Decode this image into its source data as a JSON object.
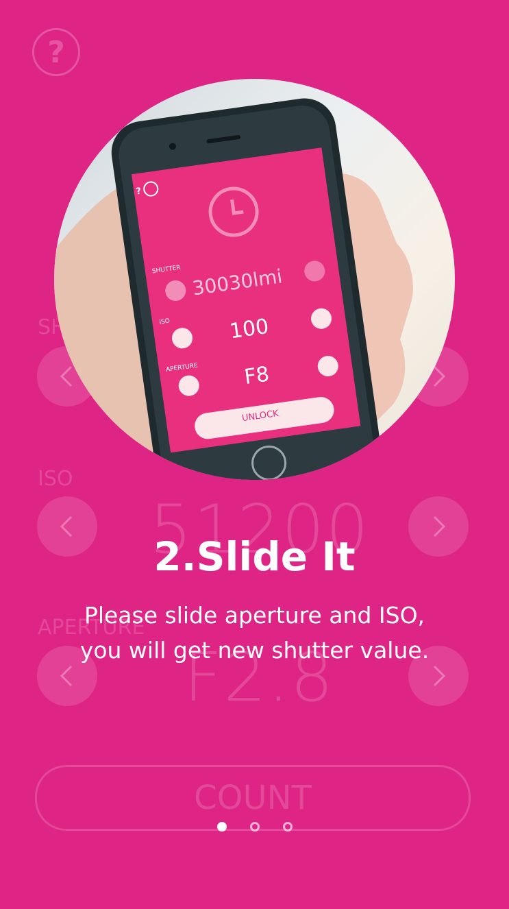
{
  "background_ui": {
    "help_glyph": "?",
    "shutter_label": "SHUTTER",
    "iso_label": "ISO",
    "iso_value": "51200",
    "aperture_label": "APERTURE",
    "aperture_value": "F2.8",
    "count_label": "COUNT"
  },
  "phone_screen": {
    "help_glyph": "?",
    "shutter_label": "SHUTTER",
    "shutter_value": "30030lmi",
    "iso_label": "ISO",
    "iso_value": "100",
    "aperture_label": "APERTURE",
    "aperture_value": "F8",
    "unlock_label": "UNLOCK"
  },
  "onboarding": {
    "title": "2.Slide It",
    "description_line1": "Please slide aperture and ISO,",
    "description_line2": "you will get new shutter value."
  },
  "pager": {
    "active_index": 0,
    "count": 3
  },
  "colors": {
    "background": "#de2586",
    "accent": "#e8307f",
    "text": "#ffffff"
  }
}
